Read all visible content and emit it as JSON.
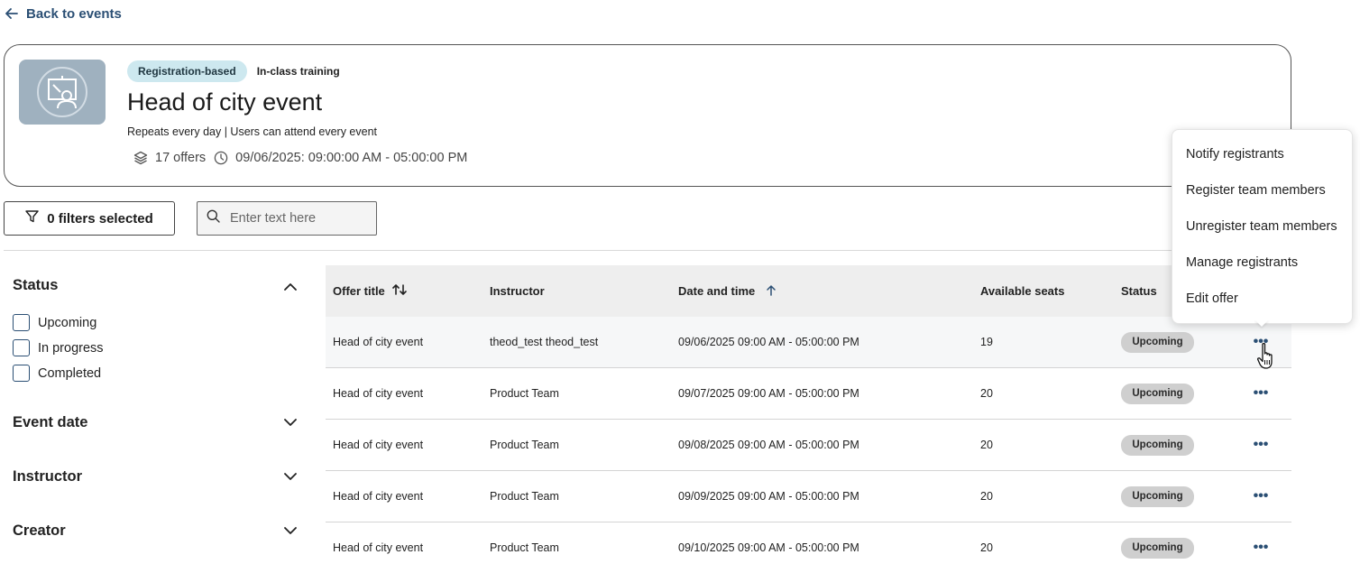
{
  "back_link": {
    "label": "Back to events"
  },
  "event": {
    "tag_registration": "Registration-based",
    "tag_type": "In-class training",
    "title": "Head of city event",
    "subtitle": "Repeats every day | Users can attend every event",
    "offers": "17 offers",
    "datetime": "09/06/2025: 09:00:00 AM - 05:00:00 PM"
  },
  "toolbar": {
    "filters_label": "0 filters selected",
    "search_placeholder": "Enter text here"
  },
  "facets": {
    "status": {
      "title": "Status",
      "options": [
        "Upcoming",
        "In progress",
        "Completed"
      ]
    },
    "event_date": {
      "title": "Event date"
    },
    "instructor": {
      "title": "Instructor"
    },
    "creator": {
      "title": "Creator"
    }
  },
  "table": {
    "headers": {
      "offer_title": "Offer title",
      "instructor": "Instructor",
      "date_time": "Date and time",
      "seats": "Available seats",
      "status": "Status"
    },
    "rows": [
      {
        "title": "Head of city event",
        "instructor": "theod_test theod_test",
        "datetime": "09/06/2025 09:00 AM - 05:00:00 PM",
        "seats": "19",
        "status": "Upcoming"
      },
      {
        "title": "Head of city event",
        "instructor": "Product Team",
        "datetime": "09/07/2025 09:00 AM - 05:00:00 PM",
        "seats": "20",
        "status": "Upcoming"
      },
      {
        "title": "Head of city event",
        "instructor": "Product Team",
        "datetime": "09/08/2025 09:00 AM - 05:00:00 PM",
        "seats": "20",
        "status": "Upcoming"
      },
      {
        "title": "Head of city event",
        "instructor": "Product Team",
        "datetime": "09/09/2025 09:00 AM - 05:00:00 PM",
        "seats": "20",
        "status": "Upcoming"
      },
      {
        "title": "Head of city event",
        "instructor": "Product Team",
        "datetime": "09/10/2025 09:00 AM - 05:00:00 PM",
        "seats": "20",
        "status": "Upcoming"
      }
    ]
  },
  "context_menu": {
    "items": [
      "Notify registrants",
      "Register team members",
      "Unregister team members",
      "Manage registrants",
      "Edit offer"
    ]
  },
  "icons": {
    "back": "arrow-left-icon",
    "thumbnail": "classroom-training-icon",
    "offers": "layers-icon",
    "clock": "clock-icon",
    "filter": "filter-icon",
    "search": "search-icon",
    "sort": "sort-icon",
    "sort_asc": "arrow-up-icon",
    "chevron_up": "chevron-up-icon",
    "chevron_down": "chevron-down-icon",
    "more": "more-options-icon",
    "cursor": "hand-pointer-icon"
  },
  "colors": {
    "link": "#2b4f74",
    "tag_registration_bg": "#cde8ef",
    "status_badge_bg": "#cfcfcf",
    "header_bg": "#eeeeee"
  }
}
